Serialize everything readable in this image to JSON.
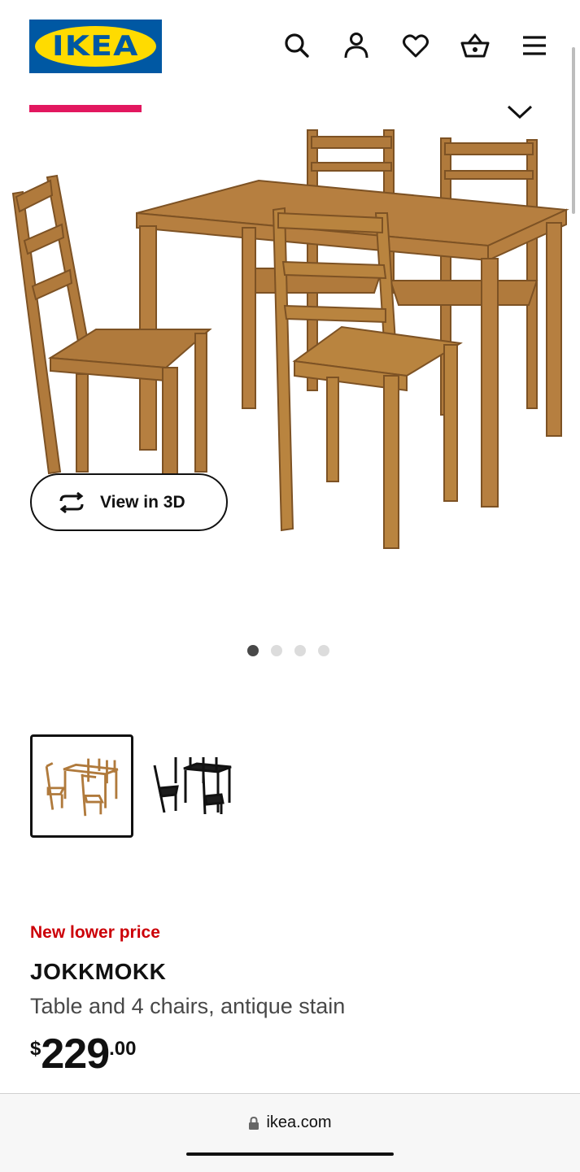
{
  "header": {
    "logo_text": "IKEA",
    "icons": [
      "search-icon",
      "account-icon",
      "heart-icon",
      "basket-icon",
      "menu-icon"
    ]
  },
  "gallery": {
    "view_3d_label": "View in 3D",
    "slide_count": 4,
    "active_slide": 1,
    "progress_color": "#e2175f"
  },
  "variants": [
    {
      "name": "antique stain",
      "selected": true
    },
    {
      "name": "black-brown",
      "selected": false
    }
  ],
  "product": {
    "badge": "New lower price",
    "name": "JOKKMOKK",
    "description": "Table and 4 chairs, antique stain",
    "price_currency": "$",
    "price_integer": "229",
    "price_decimal": ".00"
  },
  "browser": {
    "url": "ikea.com"
  },
  "colors": {
    "brand_blue": "#0058a3",
    "brand_yellow": "#ffdb00",
    "promo_red": "#cc0008"
  }
}
